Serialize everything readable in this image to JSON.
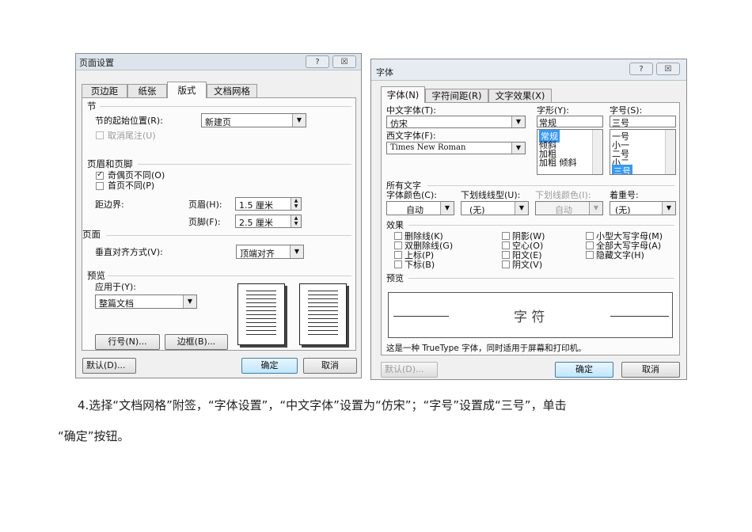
{
  "page_setup": {
    "title": "页面设置",
    "help_btn": "?",
    "close_btn": "☒",
    "tabs": [
      "页边距",
      "纸张",
      "版式",
      "文档网格"
    ],
    "section_group": "节",
    "section_start_label": "节的起始位置(R):",
    "section_start_value": "新建页",
    "suppress_endnotes": "取消尾注(U)",
    "header_footer_group": "页眉和页脚",
    "odd_even_diff": "奇偶页不同(O)",
    "first_page_diff": "首页不同(P)",
    "from_edge_label": "距边界:",
    "header_label": "页眉(H):",
    "header_value": "1.5 厘米",
    "footer_label": "页脚(F):",
    "footer_value": "2.5 厘米",
    "page_group": "页面",
    "vertical_align_label": "垂直对齐方式(V):",
    "vertical_align_value": "顶端对齐",
    "preview_group": "预览",
    "apply_to_label": "应用于(Y):",
    "apply_to_value": "整篇文档",
    "line_numbers_btn": "行号(N)...",
    "borders_btn": "边框(B)...",
    "default_btn": "默认(D)...",
    "ok_btn": "确定",
    "cancel_btn": "取消"
  },
  "font": {
    "title": "字体",
    "help_btn": "?",
    "close_btn": "☒",
    "tabs": [
      "字体(N)",
      "字符间距(R)",
      "文字效果(X)"
    ],
    "chinese_font_label": "中文字体(T):",
    "chinese_font_value": "仿宋",
    "style_label": "字形(Y):",
    "style_value": "常规",
    "style_options": [
      "常规",
      "倾斜",
      "加粗",
      "加粗 倾斜"
    ],
    "size_label": "字号(S):",
    "size_value": "三号",
    "size_options": [
      "一号",
      "小一",
      "二号",
      "小二",
      "三号"
    ],
    "western_font_label": "西文字体(F):",
    "western_font_value": "Times New Roman",
    "all_text_group": "所有文字",
    "font_color_label": "字体颜色(C):",
    "font_color_value": "自动",
    "underline_label": "下划线线型(U):",
    "underline_value": "(无)",
    "underline_color_label": "下划线颜色(I):",
    "underline_color_value": "自动",
    "emphasis_label": "着重号:",
    "emphasis_value": "(无)",
    "effects_group": "效果",
    "effects": [
      "删除线(K)",
      "阴影(W)",
      "小型大写字母(M)",
      "双删除线(G)",
      "空心(O)",
      "全部大写字母(A)",
      "上标(P)",
      "阳文(E)",
      "隐藏文字(H)",
      "下标(B)",
      "阴文(V)"
    ],
    "preview_group": "预览",
    "preview_text": "字 符",
    "note": "这是一种 TrueType 字体，同时适用于屏幕和打印机。",
    "default_btn": "默认(D)...",
    "ok_btn": "确定",
    "cancel_btn": "取消"
  },
  "instruction": {
    "line1": "4.选择“文档网格”附签，“字体设置”，“中文字体”设置为“仿宋”；“字号”设置成“三号”，单击",
    "line2": "“确定”按钮。"
  }
}
